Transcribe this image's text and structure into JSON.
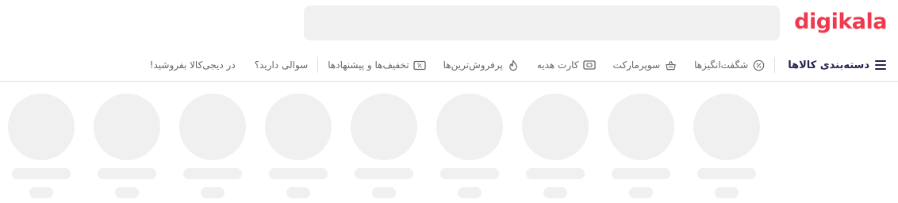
{
  "header": {
    "logo_text": "digikala",
    "brand_color": "#ef394e",
    "search_placeholder": ""
  },
  "nav": {
    "categories_label": "دسته‌بندی کالاها",
    "items": [
      {
        "label": "شگفت‌انگیزها",
        "icon": "percent-badge-icon"
      },
      {
        "label": "سوپرمارکت",
        "icon": "shopping-basket-icon"
      },
      {
        "label": "کارت هدیه",
        "icon": "gift-card-icon"
      },
      {
        "label": "پرفروش‌ترین‌ها",
        "icon": "fire-icon"
      },
      {
        "label": "تخفیف‌ها و پیشنهادها",
        "icon": "discount-ticket-icon"
      }
    ],
    "secondary": [
      {
        "label": "سوالی دارید؟"
      },
      {
        "label": "در دیجی‌کالا بفروشید!"
      }
    ]
  },
  "skeleton": {
    "placeholder_color": "#f0f0f1",
    "count": 9
  }
}
